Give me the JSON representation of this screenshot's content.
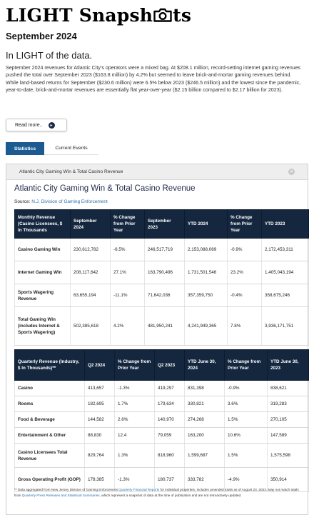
{
  "header": {
    "logo_left": "LIGHT Snapsh",
    "logo_right": "ts",
    "month": "September 2024",
    "subhead": "In LIGHT of the data.",
    "paragraph1": "September 2024 revenues for Atlantic City’s operators were a mixed bag. At $208.1 million, record-setting internet gaming revenues pushed the total over September 2023 ($163.8 million) by 4.2% but seemed to leave brick-and-mortar gaming revenues behind.",
    "paragraph2": "While land-based returns for September ($230.6 million) were 6.5% below 2023 ($246.5 million) and the lowest since the pandemic, year-to-date, brick-and-mortar revenues are essentially flat year-over-year ($2.15 billion compared to $2.17 billion for 2023).",
    "read_more": "Read more..",
    "read_more_icon": "chevron-right-icon"
  },
  "tabs": [
    {
      "label": "Statistics",
      "active": true
    },
    {
      "label": "Current Events",
      "active": false
    }
  ],
  "panel": {
    "header_label": "Atlantic City Gaming Win & Total Casino Revenue",
    "close_icon": "close-icon",
    "title": "Atlantic City Gaming Win & Total Casino Revenue",
    "source_label": "Source:",
    "source_link": "N.J. Division of Gaming Enforcement"
  },
  "table1": {
    "headers": [
      "Monthly Revenue (Casino Licensees, $ In Thousands",
      "September 2024",
      "% Change from Prior Year",
      "September 2023",
      "YTD 2024",
      "% Change from Prior Year",
      "YTD 2023"
    ],
    "rows": [
      [
        "Casino Gaming Win",
        "230,612,782",
        "-6.5%",
        "246,517,719",
        "2,153,088,069",
        "-0.9%",
        "2,172,453,311"
      ],
      [
        "Internet Gaming Win",
        "208,117,642",
        "27.1%",
        "163,790,496",
        "1,731,501,546",
        "23.2%",
        "1,405,043,194"
      ],
      [
        "Sports Wagering Revenue",
        "63,655,194",
        "-11.1%",
        "71,642,036",
        "357,359,750",
        "-0.4%",
        "358,675,246"
      ],
      [
        "Total Gaming Win (includes Internet & Sports Wagering)",
        "502,385,618",
        "4.2%",
        "481,950,241",
        "4,241,949,365",
        "7.8%",
        "3,936,171,751"
      ]
    ]
  },
  "table2": {
    "headers": [
      "Quarterly Revenue (Industry, $ In Thousands)**",
      "Q2 2024",
      "% Change from Prior Year",
      "Q2 2023",
      "YTD June 30, 2024",
      "% Change from Prior Year",
      "YTD June 30, 2023"
    ],
    "rows": [
      [
        "Casino",
        "413,657",
        "-1.3%",
        "419,297",
        "831,398",
        "-0.9%",
        "838,621"
      ],
      [
        "Rooms",
        "182,695",
        "1.7%",
        "179,634",
        "330,821",
        "3.6%",
        "319,283"
      ],
      [
        "Food & Beverage",
        "144,582",
        "2.6%",
        "140,970",
        "274,268",
        "1.5%",
        "270,105"
      ],
      [
        "Entertainment & Other",
        "88,830",
        "12.4",
        "79,059",
        "163,200",
        "10.6%",
        "147,589"
      ],
      [
        "Casino Licensees Total Revenue",
        "829,764",
        "1.3%",
        "818,960",
        "1,599,687",
        "1.5%",
        "1,575,598"
      ],
      [
        "Gross Operating Profit (GOP)",
        "178,385",
        "-1.3%",
        "180,737",
        "333,782",
        "-4.9%",
        "350,914"
      ]
    ]
  },
  "footnote": {
    "part1": "** Data aggregated from New Jersey Division of Gaming Enforcement ",
    "link1": "Quarterly Financial Reports",
    "part2": " for individual properties, includes amended totals as of August 23, 2023. May not match totals from ",
    "link2": "Quarterly Press Releases and Statistical Summaries",
    "part3": ", which represent a snapshot of data at the time of publication and are not retroactively updated."
  }
}
